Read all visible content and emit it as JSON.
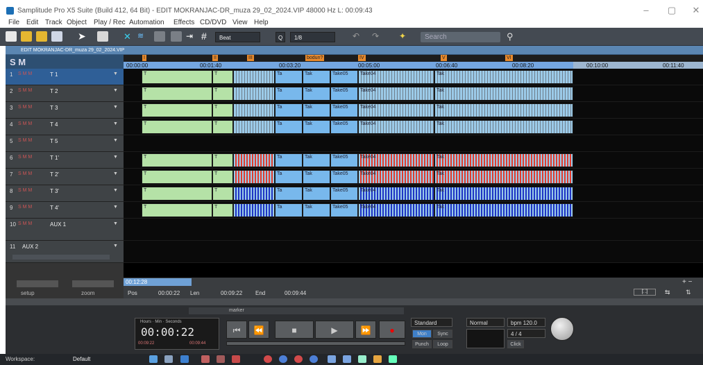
{
  "window": {
    "title": "Samplitude Pro X5 Suite (Build 412, 64 Bit)  -  EDIT MOKRANJAC-DR_muza 29_02_2024.VIP   48000 Hz L: 00:09:43",
    "minimize_symbol": "–",
    "maximize_symbol": "▢",
    "close_symbol": "✕"
  },
  "menu": [
    "File",
    "Edit",
    "Track",
    "Object",
    "Play / Rec",
    "Automation",
    "Effects",
    "CD/DVD",
    "View",
    "Help"
  ],
  "toolbar": {
    "snap_mode": "Beat",
    "q_label": "Q",
    "quantize": "1/8",
    "search_placeholder": "Search"
  },
  "project_tab": "EDIT MOKRANJAC-DR_muza 29_02_2024.VIP",
  "header": {
    "sm_label": "S M"
  },
  "ruler_ticks": [
    "00:00:00",
    "00:01:40",
    "00:03:20",
    "00:05:00",
    "00:06:40",
    "00:08:20",
    "00:10:00",
    "00:11:40"
  ],
  "markers": [
    "I",
    "II",
    "III",
    "bodun?",
    "IV",
    "V",
    "VI"
  ],
  "tracks": [
    {
      "num": "1",
      "name": "T 1"
    },
    {
      "num": "2",
      "name": "T 2"
    },
    {
      "num": "3",
      "name": "T 3"
    },
    {
      "num": "4",
      "name": "T 4"
    },
    {
      "num": "5",
      "name": "T 5"
    },
    {
      "num": "6",
      "name": "T 1'"
    },
    {
      "num": "7",
      "name": "T 2'"
    },
    {
      "num": "8",
      "name": "T 3'"
    },
    {
      "num": "9",
      "name": "T 4'"
    },
    {
      "num": "10",
      "name": "AUX 1"
    },
    {
      "num": "11",
      "name": "AUX 2"
    }
  ],
  "track_buttons": "S M  M",
  "clip_labels": {
    "t": "T",
    "ta": "Ta",
    "tak": "Tak",
    "take05": "Take05",
    "take04": "Take04"
  },
  "bottom": {
    "setup": "setup",
    "zoom": "zoom",
    "position_time": "00:12:28",
    "pos_label": "Pos",
    "pos_value": "00:00:22",
    "len_label": "Len",
    "len_value": "00:09:22",
    "end_label": "End",
    "end_value": "00:09:44",
    "marker_label": "marker"
  },
  "transport": {
    "clock_format": "Hours · Min · Seconds",
    "clock_time": "00:00:22",
    "clock_range_left": "00:09:22",
    "clock_range_right": "00:09:44",
    "standard_mode": "Standard",
    "normal_mode": "Normal",
    "bpm": "bpm 120.0",
    "signature": "4 / 4",
    "mon": "Mon",
    "sync": "Sync",
    "punch": "Punch",
    "loop": "Loop",
    "click": "Click"
  },
  "status": {
    "workspace_label": "Workspace:",
    "workspace_value": "Default"
  }
}
